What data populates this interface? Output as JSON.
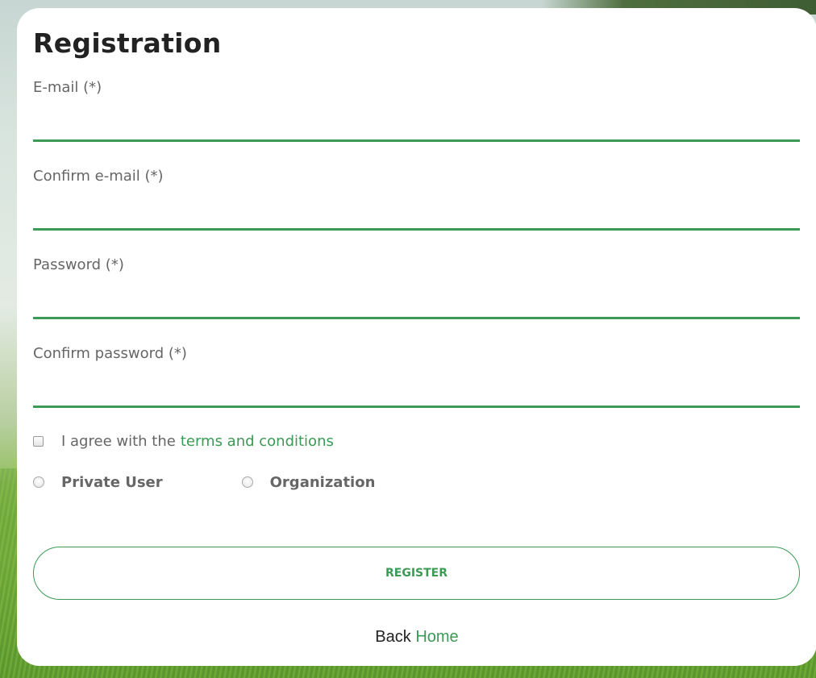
{
  "form": {
    "title": "Registration",
    "fields": [
      {
        "label": "E-mail (*)",
        "value": ""
      },
      {
        "label": "Confirm e-mail (*)",
        "value": ""
      },
      {
        "label": "Password (*)",
        "value": ""
      },
      {
        "label": "Confirm password (*)",
        "value": ""
      }
    ],
    "agree": {
      "checked": false,
      "text": "I agree with the",
      "link_text": "terms and conditions"
    },
    "user_type": {
      "options": [
        "Private User",
        "Organization"
      ],
      "selected": null
    },
    "register_label": "REGISTER",
    "back": {
      "text": "Back",
      "link_text": "Home"
    }
  },
  "colors": {
    "accent": "#3b9a55",
    "label": "#666666",
    "title": "#222222",
    "card_background": "#ffffff"
  }
}
